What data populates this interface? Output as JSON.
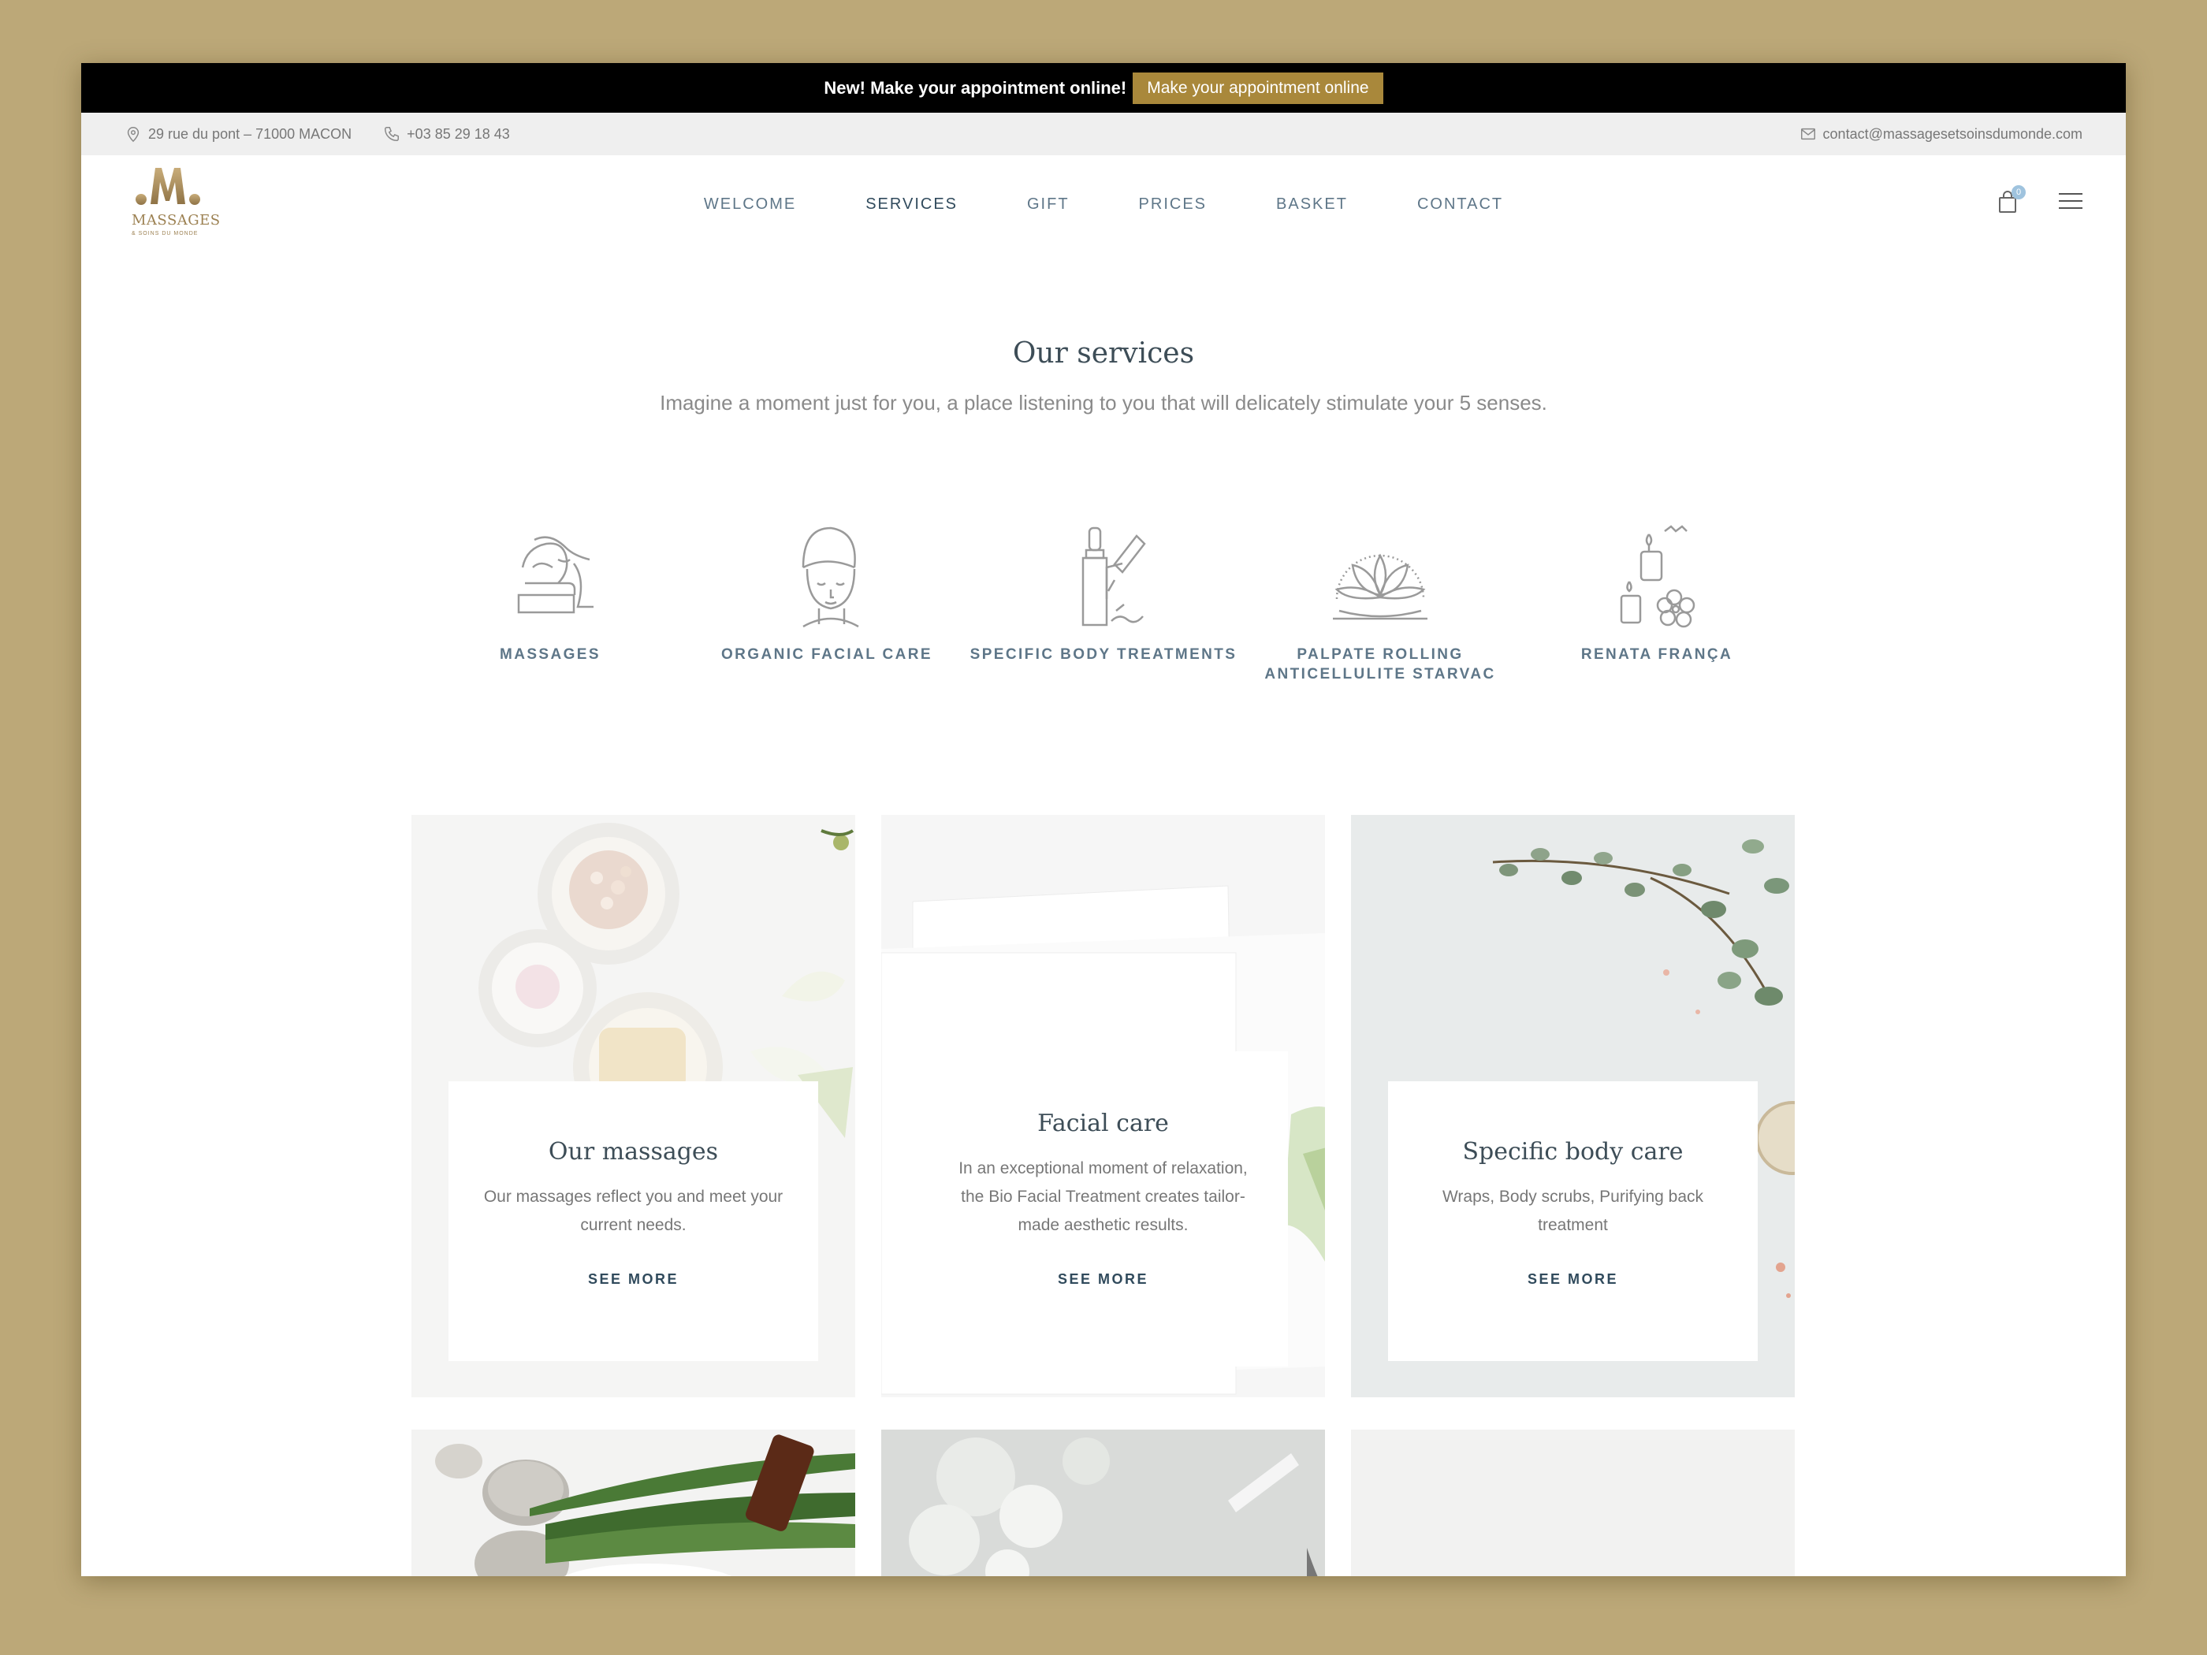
{
  "promo": {
    "text": "New! Make your appointment online!",
    "button": "Make your appointment online"
  },
  "infobar": {
    "address": "29 rue du pont – 71000 MACON",
    "phone": "+03 85 29 18 43",
    "email": "contact@massagesetsoinsdumonde.com"
  },
  "logo": {
    "line1": "MASSAGES",
    "line2": "& SOINS DU MONDE"
  },
  "nav": [
    "WELCOME",
    "SERVICES",
    "GIFT",
    "PRICES",
    "BASKET",
    "CONTACT"
  ],
  "cart_count": "0",
  "section": {
    "title": "Our services",
    "subtitle": "Imagine a moment just for you, a place listening to you that will delicately stimulate your 5 senses."
  },
  "services": [
    {
      "label": "MASSAGES",
      "icon": "massage-icon"
    },
    {
      "label": "ORGANIC FACIAL CARE",
      "icon": "facial-care-icon"
    },
    {
      "label": "SPECIFIC BODY TREATMENTS",
      "icon": "serum-bottle-icon"
    },
    {
      "label_line1": "PALPATE ROLLING",
      "label_line2": "ANTICELLULITE STARVAC",
      "icon": "lotus-icon"
    },
    {
      "label": "RENATA FRANÇA",
      "icon": "candles-icon"
    }
  ],
  "cards": [
    {
      "title": "Our massages",
      "desc_line1": "Our massages reflect you and meet your",
      "desc_line2": "current needs.",
      "link": "SEE MORE"
    },
    {
      "title": "Facial care",
      "desc_line1": "In an exceptional moment of relaxation,",
      "desc_line2": "the Bio Facial Treatment creates tailor-",
      "desc_line3": "made aesthetic results.",
      "link": "SEE MORE"
    },
    {
      "title": "Specific body care",
      "desc_line1": "Wraps, Body scrubs, Purifying back",
      "desc_line2": "treatment",
      "link": "SEE MORE"
    }
  ],
  "colors": {
    "gold": "#a9883b",
    "nav_text": "#5e7688",
    "highlight": "#dde6ec",
    "background": "#bca878"
  }
}
